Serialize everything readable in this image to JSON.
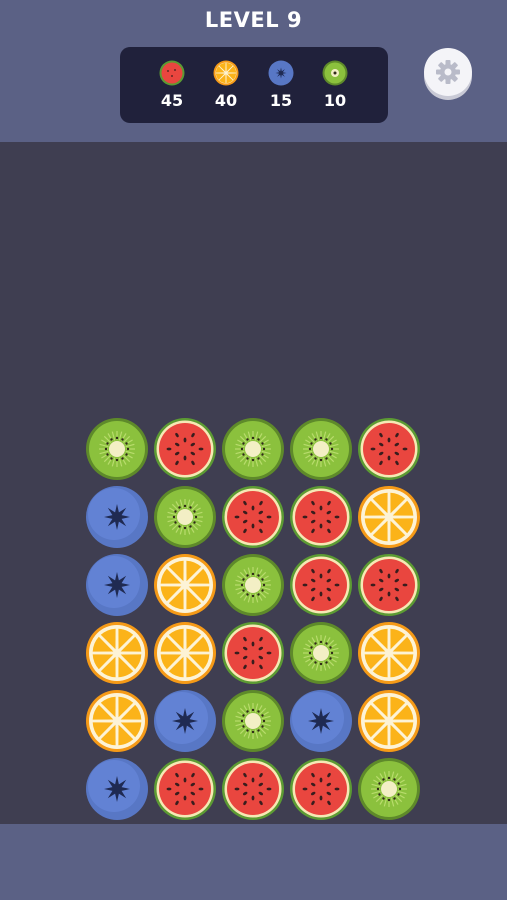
{
  "level_title": "LEVEL 9",
  "goals": [
    {
      "fruit": "watermelon",
      "count": "45"
    },
    {
      "fruit": "orange",
      "count": "40"
    },
    {
      "fruit": "blueberry",
      "count": "15"
    },
    {
      "fruit": "kiwi",
      "count": "10"
    }
  ],
  "settings_icon": "gear-icon",
  "colors": {
    "header_bg": "#5b6185",
    "board_bg": "#3f3e51",
    "goal_panel_bg": "#20213b",
    "watermelon": "#e9463f",
    "orange": "#fbb319",
    "blueberry": "#5b78c9",
    "kiwi": "#8bc13d"
  },
  "board": [
    [
      "kiwi",
      "watermelon",
      "kiwi",
      "kiwi",
      "watermelon"
    ],
    [
      "blueberry",
      "kiwi",
      "watermelon",
      "watermelon",
      "orange"
    ],
    [
      "blueberry",
      "orange",
      "kiwi",
      "watermelon",
      "watermelon"
    ],
    [
      "orange",
      "orange",
      "watermelon",
      "kiwi",
      "orange"
    ],
    [
      "orange",
      "blueberry",
      "kiwi",
      "blueberry",
      "orange"
    ],
    [
      "blueberry",
      "watermelon",
      "watermelon",
      "watermelon",
      "kiwi"
    ]
  ]
}
